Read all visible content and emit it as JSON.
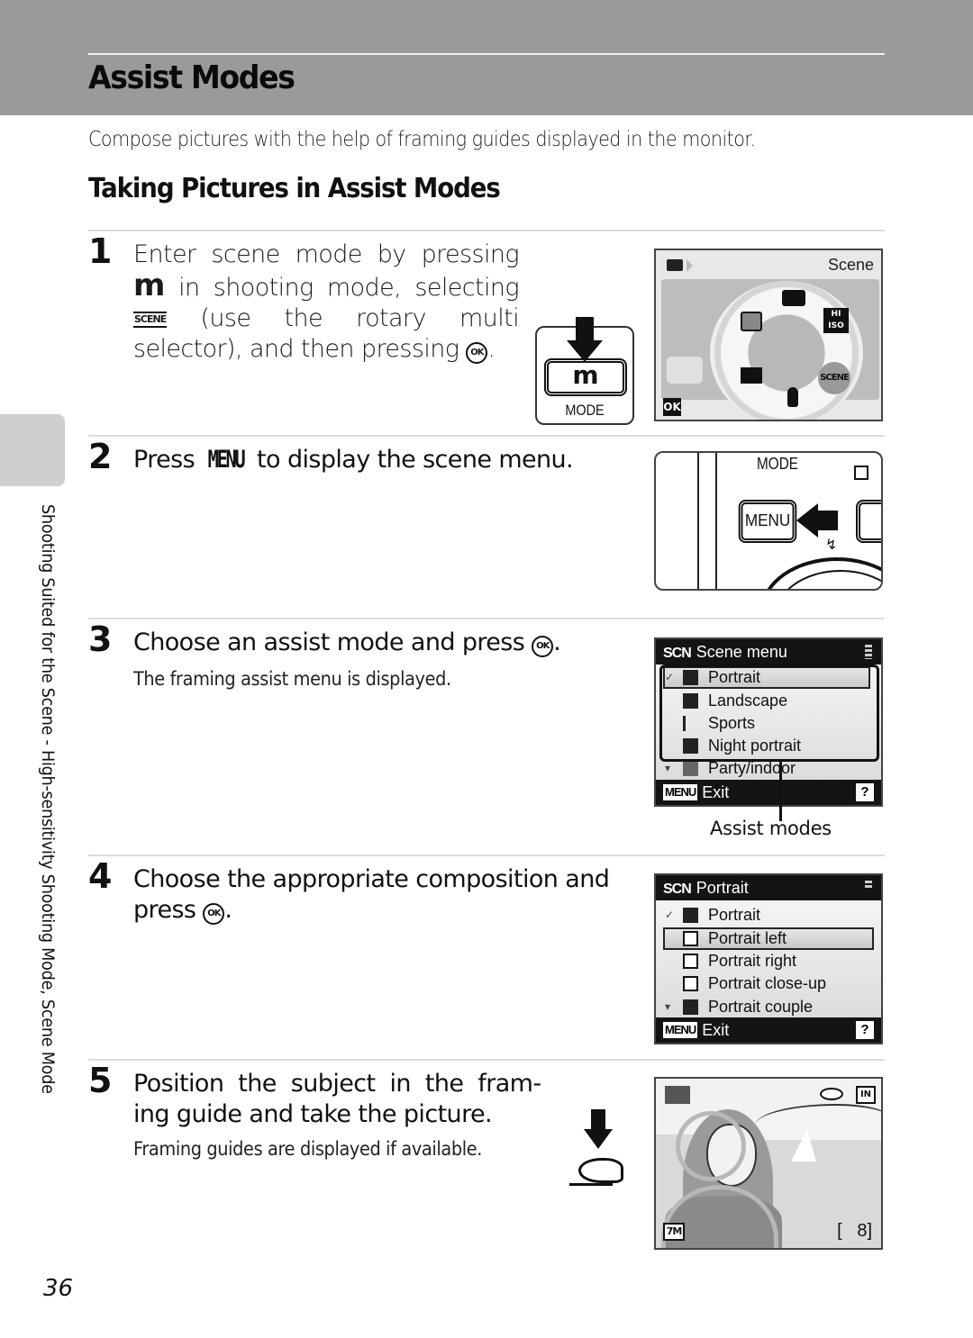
{
  "header": {
    "title": "Assist Modes",
    "band_color": "#9a9a9a"
  },
  "intro": "Compose pictures with the help of framing guides displayed in the monitor.",
  "section_title": "Taking Pictures in Assist Modes",
  "side_tab": {
    "text": "Shooting Suited for the Scene - High-sensitivity Shooting Mode, Scene Mode"
  },
  "steps": [
    {
      "number": "1",
      "text_parts": [
        "Enter scene mode by pressing ",
        "m",
        " in shooting mode, selecting ",
        "SCENE",
        " (use the rotary multi selector), and then pressing ",
        "OK",
        "."
      ],
      "figure": {
        "mode_button": {
          "glyph": "m",
          "label": "MODE"
        },
        "screen": {
          "title": "Scene",
          "dial_items": [
            "camera-icon",
            "hi-iso-icon",
            "scene-icon",
            "voice-recording-icon",
            "movie-icon",
            "setup-icon"
          ],
          "hi_iso_label": "HI ISO",
          "scene_label": "SCENE",
          "ok_label": "OK"
        }
      }
    },
    {
      "number": "2",
      "text_parts": [
        "Press ",
        "MENU",
        " to display the scene menu."
      ],
      "figure": {
        "mode_label": "MODE",
        "menu_button_label": "MENU"
      }
    },
    {
      "number": "3",
      "text_parts": [
        "Choose an assist mode and press ",
        "OK",
        "."
      ],
      "note": "The framing assist menu is displayed.",
      "figure": {
        "title_icon": "SCN",
        "title": "Scene menu",
        "items": [
          {
            "label": "Portrait",
            "icon": "portrait-icon",
            "checked": true,
            "selected": true
          },
          {
            "label": "Landscape",
            "icon": "landscape-icon"
          },
          {
            "label": "Sports",
            "icon": "sports-icon"
          },
          {
            "label": "Night portrait",
            "icon": "night-portrait-icon"
          },
          {
            "label": "Party/indoor",
            "icon": "party-indoor-icon"
          }
        ],
        "footer_key": "MENU",
        "footer_label": "Exit",
        "help": "?",
        "callout": "Assist modes"
      }
    },
    {
      "number": "4",
      "text_parts": [
        "Choose the appropriate composition and press ",
        "OK",
        "."
      ],
      "figure": {
        "title_icon": "SCN",
        "title": "Portrait",
        "items": [
          {
            "label": "Portrait",
            "icon": "portrait-icon",
            "checked": true
          },
          {
            "label": "Portrait left",
            "icon": "portrait-left-icon",
            "selected": true
          },
          {
            "label": "Portrait right",
            "icon": "portrait-right-icon"
          },
          {
            "label": "Portrait close-up",
            "icon": "portrait-closeup-icon"
          },
          {
            "label": "Portrait couple",
            "icon": "portrait-couple-icon"
          }
        ],
        "footer_key": "MENU",
        "footer_label": "Exit",
        "help": "?"
      }
    },
    {
      "number": "5",
      "text_lines": [
        "Position the subject in the fram-",
        "ing guide and take the picture."
      ],
      "note": "Framing guides are displayed if available.",
      "figure": {
        "image_size": "7M",
        "storage": "IN",
        "exposures_remaining": "8"
      }
    }
  ],
  "page_number": "36"
}
